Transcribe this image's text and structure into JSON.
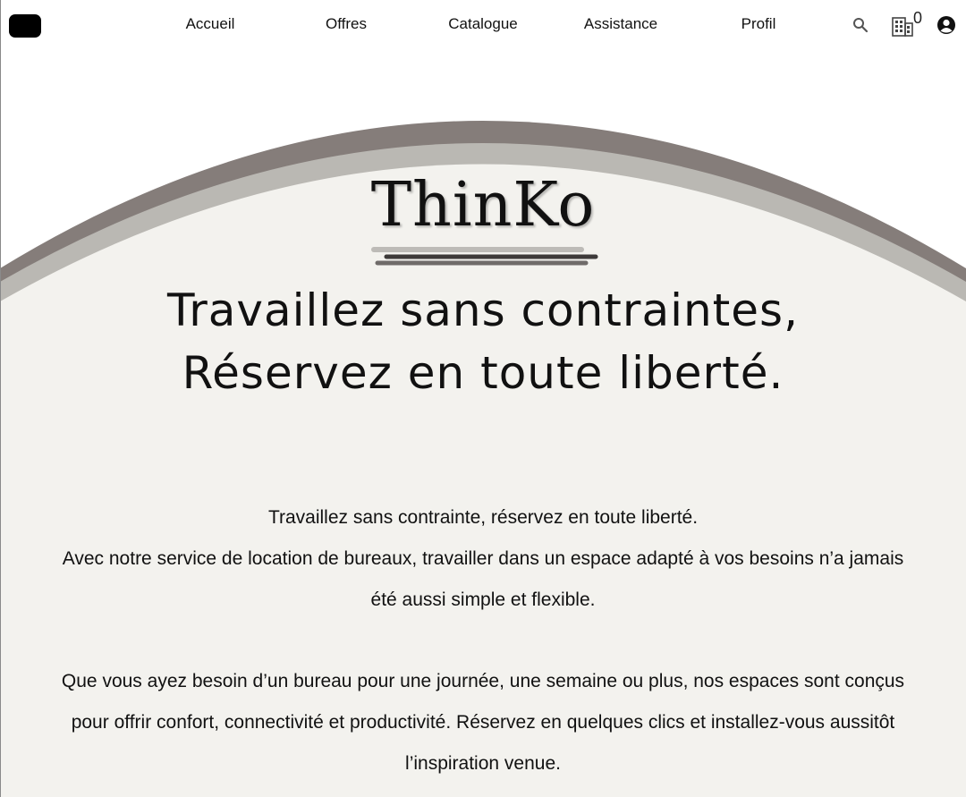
{
  "nav": {
    "items": [
      {
        "label": "Accueil"
      },
      {
        "label": "Offres"
      },
      {
        "label": "Catalogue"
      },
      {
        "label": "Assistance"
      },
      {
        "label": "Profil"
      }
    ],
    "icons": [
      "search-icon",
      "building-icon",
      "account-icon"
    ],
    "building_count": "0"
  },
  "hero": {
    "brand": "ThinKo",
    "tagline_line1": "Travaillez sans contraintes,",
    "tagline_line2": "Réservez en toute liberté.",
    "paragraph1_line1": "Travaillez sans contrainte, réservez en toute liberté.",
    "paragraph1_line2": "Avec notre service de location de bureaux, travailler dans un espace adapté à vos besoins n’a jamais",
    "paragraph1_line3": "été aussi simple et flexible.",
    "paragraph2_line1": "Que vous ayez besoin d’un bureau pour une journée, une semaine ou plus, nos espaces sont conçus",
    "paragraph2_line2": "pour offrir confort, connectivité et productivité. Réservez en quelques clics et installez-vous aussitôt",
    "paragraph2_line3": "l’inspiration venue."
  },
  "colors": {
    "arch_outer": "#857d7a",
    "arch_inner": "#bab8b3",
    "panel": "#f3f2ee",
    "underline_light": "#bdbbb7",
    "underline_dark": "#3d3a39",
    "underline_mid": "#6f6b69"
  }
}
